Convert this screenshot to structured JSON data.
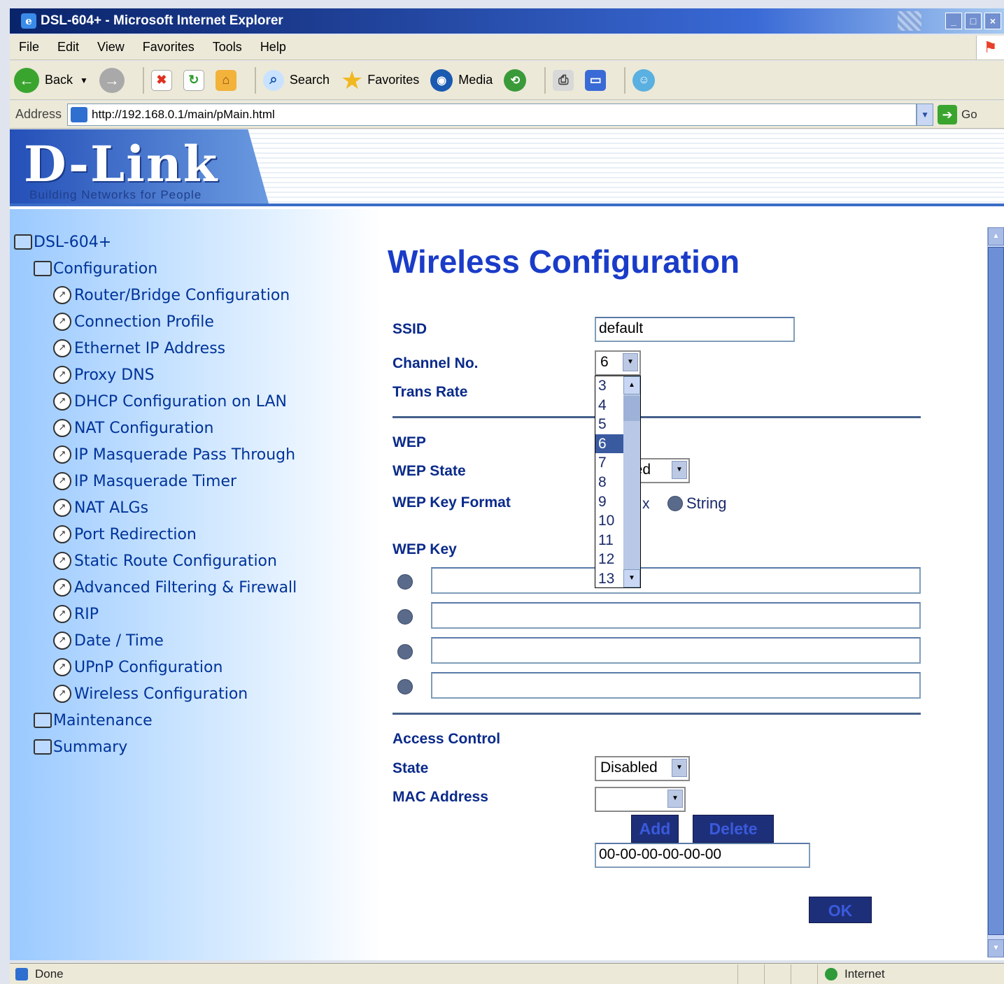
{
  "window": {
    "title": "DSL-604+ - Microsoft Internet Explorer"
  },
  "menu": [
    "File",
    "Edit",
    "View",
    "Favorites",
    "Tools",
    "Help"
  ],
  "toolbar": {
    "back": "Back",
    "search": "Search",
    "favorites": "Favorites",
    "media": "Media"
  },
  "address": {
    "label": "Address",
    "url": "http://192.168.0.1/main/pMain.html",
    "go": "Go"
  },
  "banner": {
    "brand": "D-Link",
    "tagline": "Building Networks for People"
  },
  "tree": {
    "root": "DSL-604+",
    "configuration": "Configuration",
    "items": [
      "Router/Bridge Configuration",
      "Connection Profile",
      "Ethernet IP Address",
      "Proxy DNS",
      "DHCP Configuration on LAN",
      "NAT Configuration",
      "IP Masquerade Pass Through",
      "IP Masquerade Timer",
      "NAT ALGs",
      "Port Redirection",
      "Static Route Configuration",
      "Advanced Filtering & Firewall",
      "RIP",
      "Date / Time",
      "UPnP Configuration",
      "Wireless Configuration"
    ],
    "maintenance": "Maintenance",
    "summary": "Summary"
  },
  "form": {
    "title": "Wireless Configuration",
    "ssid_label": "SSID",
    "ssid_value": "default",
    "channel_label": "Channel No.",
    "channel_value": "6",
    "channel_options": [
      "3",
      "4",
      "5",
      "6",
      "7",
      "8",
      "9",
      "10",
      "11",
      "12",
      "13"
    ],
    "trans_rate_label": "Trans Rate",
    "wep_label": "WEP",
    "wep_state_label": "WEP State",
    "wep_state_value": "led",
    "wep_key_format_label": "WEP Key Format",
    "wep_key_format_hex_fragment": "x",
    "wep_key_format_string": "String",
    "wep_key_label": "WEP Key",
    "access_control_label": "Access Control",
    "state_label": "State",
    "state_value": "Disabled",
    "mac_label": "MAC Address",
    "add": "Add",
    "delete": "Delete",
    "mac_value": "00-00-00-00-00-00",
    "ok": "OK"
  },
  "status": {
    "text": "Done",
    "zone": "Internet"
  }
}
